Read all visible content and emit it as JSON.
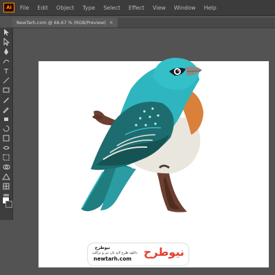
{
  "app": {
    "logo_text": "Ai"
  },
  "menu": [
    "File",
    "Edit",
    "Object",
    "Type",
    "Select",
    "Effect",
    "View",
    "Window",
    "Help"
  ],
  "document_tab": {
    "title": "NewTarh.com @ 66.67 % (RGB/Preview)",
    "close_symbol": "×"
  },
  "tools": [
    "selection-tool",
    "direct-selection-tool",
    "pen-tool",
    "curvature-tool",
    "type-tool",
    "line-segment-tool",
    "rectangle-tool",
    "paintbrush-tool",
    "pencil-tool",
    "eraser-tool",
    "rotate-tool",
    "scale-tool",
    "width-tool",
    "free-transform-tool",
    "shape-builder-tool",
    "perspective-grid-tool",
    "mesh-tool",
    "gradient-tool"
  ],
  "swatches": {
    "fill": "#ffffff"
  },
  "colors": {
    "ui_bg": "#535353",
    "artboard": "#ffffff",
    "bird_teal": "#2fb5bf",
    "bird_orange": "#d9803b",
    "branch_brown": "#6b4030",
    "brand_red": "#e53e2d"
  },
  "watermark": {
    "brand": "نیوطرح",
    "title": "نیوطرح",
    "subtitle": "دانلود طرح لایه باز، بنر و تراکت",
    "url": "newtarh.com"
  }
}
